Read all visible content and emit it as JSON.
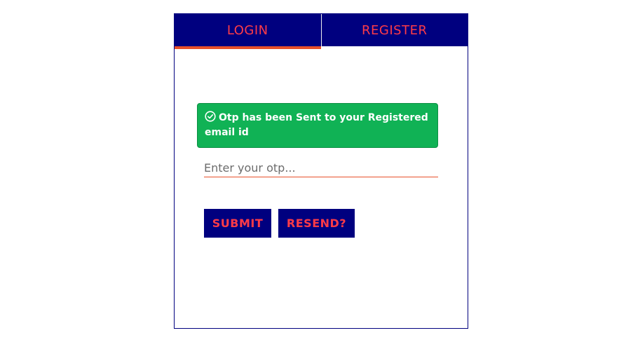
{
  "tabs": [
    {
      "label": "LOGIN",
      "active": true
    },
    {
      "label": "REGISTER",
      "active": false
    }
  ],
  "alert": {
    "icon": "check-circle-icon",
    "message": "Otp has been Sent to your Registered email id",
    "color": "#10b255"
  },
  "otp": {
    "value": "",
    "placeholder": "Enter your otp..."
  },
  "buttons": {
    "submit_label": "SUBMIT",
    "resend_label": "RESEND?"
  },
  "colors": {
    "navy": "#00007f",
    "accent_red": "#ff3b47",
    "underline": "#e8502a"
  }
}
